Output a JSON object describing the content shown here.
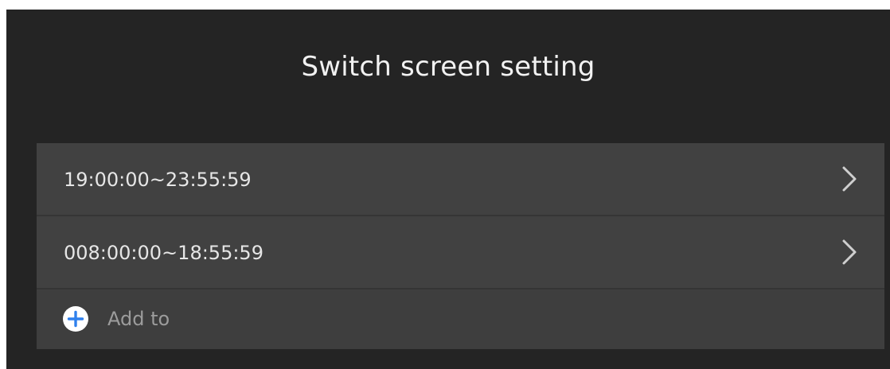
{
  "title": "Switch screen setting",
  "schedules": [
    {
      "label": "19:00:00~23:55:59",
      "icon": "chevron-right-icon"
    },
    {
      "label": "008:00:00~18:55:59",
      "icon": "chevron-right-icon"
    }
  ],
  "add": {
    "label": "Add to",
    "icon": "plus-circle-icon",
    "icon_color": "#2f80ed"
  },
  "colors": {
    "background": "#242424",
    "row": "#414141",
    "text": "#e6e6e6",
    "muted_text": "#9c9c9c"
  }
}
